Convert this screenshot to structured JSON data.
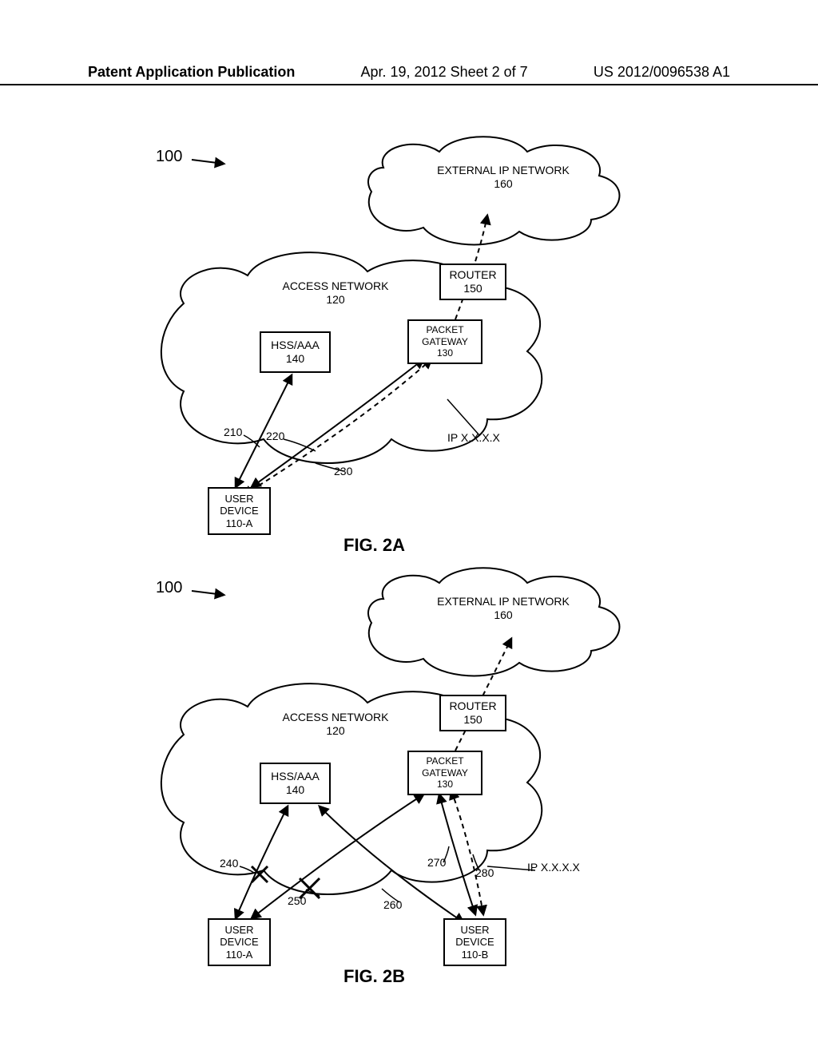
{
  "header": {
    "left": "Patent Application Publication",
    "mid": "Apr. 19, 2012  Sheet 2 of 7",
    "right": "US 2012/0096538 A1"
  },
  "figA": {
    "ref100": "100",
    "external_ip_network": {
      "name": "EXTERNAL IP NETWORK",
      "num": "160"
    },
    "access_network": {
      "name": "ACCESS NETWORK",
      "num": "120"
    },
    "router": {
      "name": "ROUTER",
      "num": "150"
    },
    "packet_gateway": {
      "name": "PACKET",
      "name2": "GATEWAY",
      "num": "130"
    },
    "hss_aaa": {
      "name": "HSS/AAA",
      "num": "140"
    },
    "user_device_a": {
      "name": "USER",
      "name2": "DEVICE",
      "num": "110-A"
    },
    "ip_label": "IP X.X.X.X",
    "flow210": "210",
    "flow220": "220",
    "flow230": "230",
    "caption": "FIG. 2A"
  },
  "figB": {
    "ref100": "100",
    "external_ip_network": {
      "name": "EXTERNAL IP NETWORK",
      "num": "160"
    },
    "access_network": {
      "name": "ACCESS NETWORK",
      "num": "120"
    },
    "router": {
      "name": "ROUTER",
      "num": "150"
    },
    "packet_gateway": {
      "name": "PACKET",
      "name2": "GATEWAY",
      "num": "130"
    },
    "hss_aaa": {
      "name": "HSS/AAA",
      "num": "140"
    },
    "user_device_a": {
      "name": "USER",
      "name2": "DEVICE",
      "num": "110-A"
    },
    "user_device_b": {
      "name": "USER",
      "name2": "DEVICE",
      "num": "110-B"
    },
    "ip_label": "IP X.X.X.X",
    "flow240": "240",
    "flow250": "250",
    "flow260": "260",
    "flow270": "270",
    "flow280": "280",
    "caption": "FIG. 2B"
  }
}
